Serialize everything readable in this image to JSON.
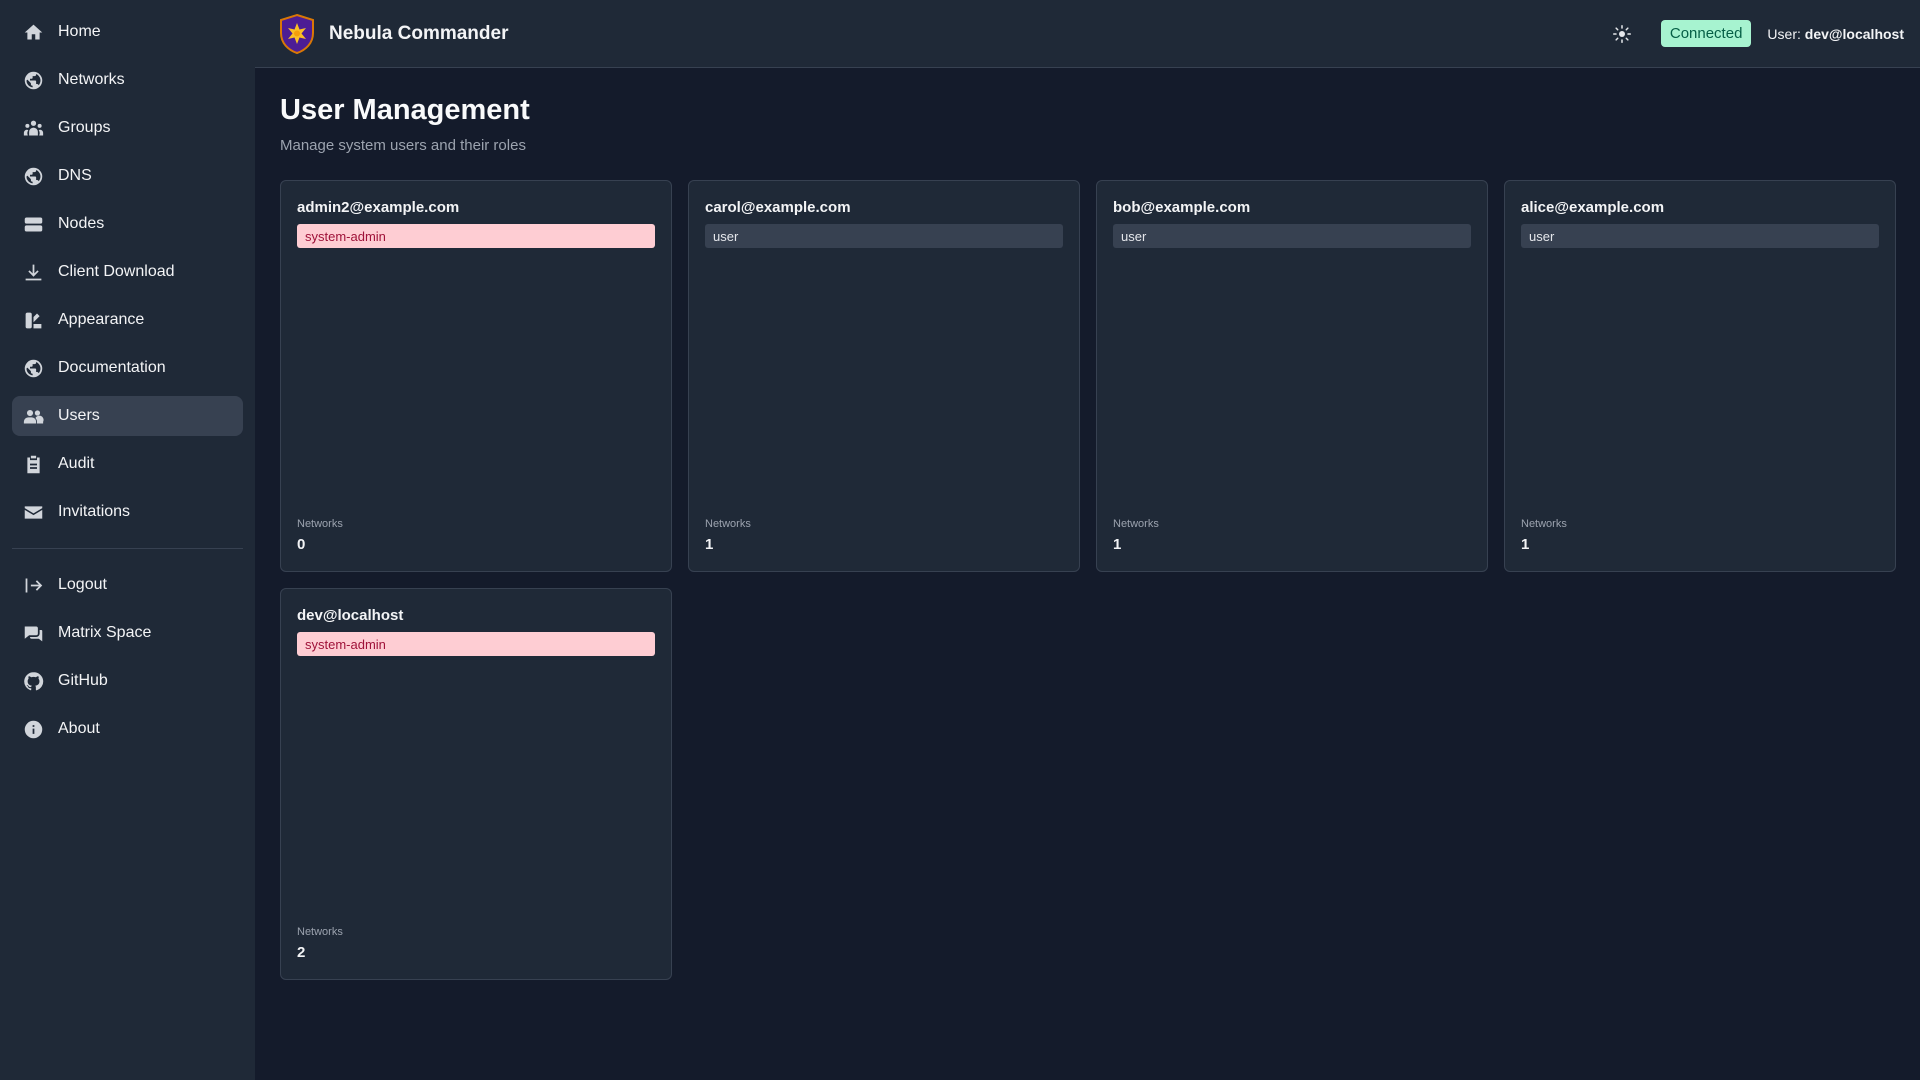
{
  "app": {
    "title": "Nebula Commander",
    "status": "Connected",
    "user_prefix": "User:",
    "user_name": "dev@localhost"
  },
  "sidebar": {
    "items": [
      {
        "label": "Home",
        "icon": "home-icon"
      },
      {
        "label": "Networks",
        "icon": "globe-icon"
      },
      {
        "label": "Groups",
        "icon": "groups-icon"
      },
      {
        "label": "DNS",
        "icon": "globe-icon"
      },
      {
        "label": "Nodes",
        "icon": "server-icon"
      },
      {
        "label": "Client Download",
        "icon": "download-icon"
      },
      {
        "label": "Appearance",
        "icon": "palette-icon"
      },
      {
        "label": "Documentation",
        "icon": "globe-icon"
      },
      {
        "label": "Users",
        "icon": "users-icon",
        "active": true
      },
      {
        "label": "Audit",
        "icon": "clipboard-icon"
      },
      {
        "label": "Invitations",
        "icon": "mail-icon"
      }
    ],
    "footer_items": [
      {
        "label": "Logout",
        "icon": "logout-icon"
      },
      {
        "label": "Matrix Space",
        "icon": "chat-icon"
      },
      {
        "label": "GitHub",
        "icon": "github-icon"
      },
      {
        "label": "About",
        "icon": "info-icon"
      }
    ]
  },
  "main": {
    "title": "User Management",
    "subtitle": "Manage system users and their roles",
    "users": [
      {
        "email": "admin2@example.com",
        "role": "system-admin",
        "networks_label": "Networks",
        "networks": "0"
      },
      {
        "email": "carol@example.com",
        "role": "user",
        "networks_label": "Networks",
        "networks": "1"
      },
      {
        "email": "bob@example.com",
        "role": "user",
        "networks_label": "Networks",
        "networks": "1"
      },
      {
        "email": "alice@example.com",
        "role": "user",
        "networks_label": "Networks",
        "networks": "1"
      },
      {
        "email": "dev@localhost",
        "role": "system-admin",
        "networks_label": "Networks",
        "networks": "2"
      }
    ]
  },
  "colors": {
    "background": "#141b2b",
    "panel": "#1f2937",
    "connected_badge": "#a7f3d0",
    "admin_badge": "#fecdd3"
  }
}
